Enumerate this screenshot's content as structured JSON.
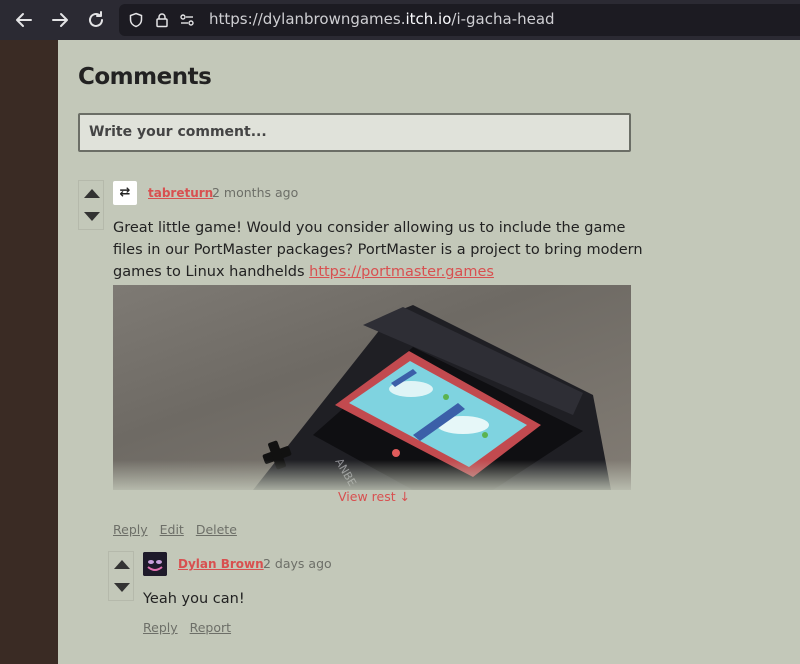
{
  "browser": {
    "url_prefix": "https://dylanbrowngames.",
    "url_host": "itch.io",
    "url_path": "/i-gacha-head"
  },
  "comments": {
    "heading": "Comments",
    "input_placeholder": "Write your comment...",
    "items": [
      {
        "author": "tabreturn",
        "avatar_glyph": "⇄",
        "time": "2 months ago",
        "text_lines": [
          "Great little game! Would you consider allowing us to include the game",
          "files in our PortMaster packages? PortMaster is a project to bring modern",
          "games to Linux handhelds "
        ],
        "link": "https://portmaster.games",
        "view_rest": "View rest ↓",
        "actions": [
          "Reply",
          "Edit",
          "Delete"
        ]
      },
      {
        "author": "Dylan Brown",
        "time": "2 days ago",
        "text": "Yeah you can!",
        "actions": [
          "Reply",
          "Report"
        ]
      }
    ]
  },
  "icons": [
    "back-arrow-icon",
    "forward-arrow-icon",
    "reload-icon",
    "shield-icon",
    "lock-icon",
    "permissions-icon",
    "upvote-icon",
    "downvote-icon"
  ],
  "colors": {
    "link": "#d85050",
    "page_bg": "#c3c8b9",
    "sidebar": "#3a2b24",
    "chrome": "#2b2a33"
  }
}
